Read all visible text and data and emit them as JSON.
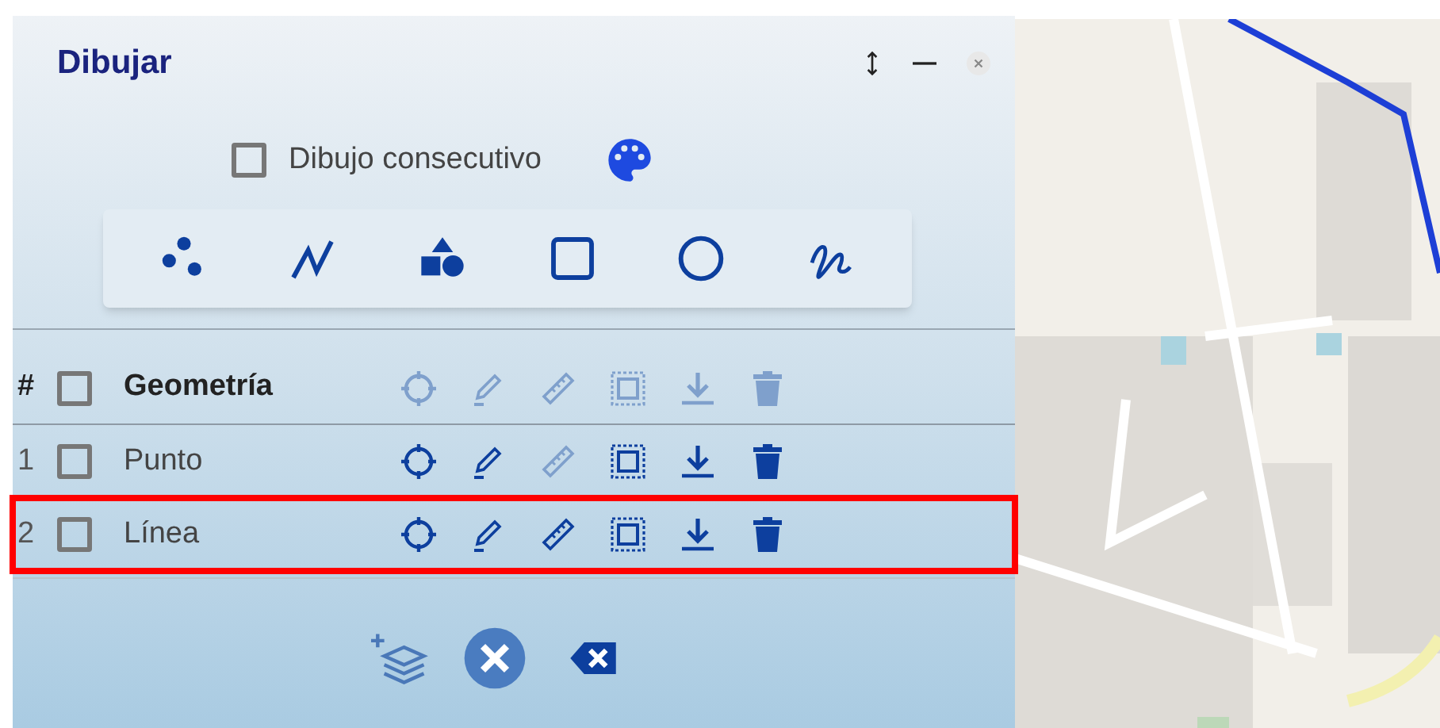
{
  "panel": {
    "title": "Dibujar",
    "header_controls": [
      {
        "kind": "resize"
      },
      {
        "kind": "minimize"
      },
      {
        "kind": "close"
      }
    ]
  },
  "consecutive": {
    "label": "Dibujo consecutivo",
    "checked": false
  },
  "tools": [
    {
      "kind": "points"
    },
    {
      "kind": "line"
    },
    {
      "kind": "shapes"
    },
    {
      "kind": "square"
    },
    {
      "kind": "circle"
    },
    {
      "kind": "freehand"
    }
  ],
  "table": {
    "header": {
      "number": "#",
      "label": "Geometría",
      "checked": false,
      "actions": [
        {
          "kind": "locate",
          "enabled": false
        },
        {
          "kind": "edit",
          "enabled": false
        },
        {
          "kind": "measure",
          "enabled": false
        },
        {
          "kind": "select",
          "enabled": false
        },
        {
          "kind": "download",
          "enabled": false
        },
        {
          "kind": "delete",
          "enabled": false
        }
      ]
    },
    "rows": [
      {
        "number": "1",
        "label": "Punto",
        "checked": false,
        "highlighted": false,
        "actions": [
          {
            "kind": "locate",
            "enabled": true
          },
          {
            "kind": "edit",
            "enabled": true
          },
          {
            "kind": "measure",
            "enabled": false
          },
          {
            "kind": "select",
            "enabled": true
          },
          {
            "kind": "download",
            "enabled": true
          },
          {
            "kind": "delete",
            "enabled": true
          }
        ]
      },
      {
        "number": "2",
        "label": "Línea",
        "checked": false,
        "highlighted": true,
        "actions": [
          {
            "kind": "locate",
            "enabled": true
          },
          {
            "kind": "edit",
            "enabled": true
          },
          {
            "kind": "measure",
            "enabled": true
          },
          {
            "kind": "select",
            "enabled": true
          },
          {
            "kind": "download",
            "enabled": true
          },
          {
            "kind": "delete",
            "enabled": true
          }
        ]
      }
    ]
  },
  "footer_buttons": [
    {
      "kind": "add_layer"
    },
    {
      "kind": "cancel"
    },
    {
      "kind": "clear"
    }
  ]
}
